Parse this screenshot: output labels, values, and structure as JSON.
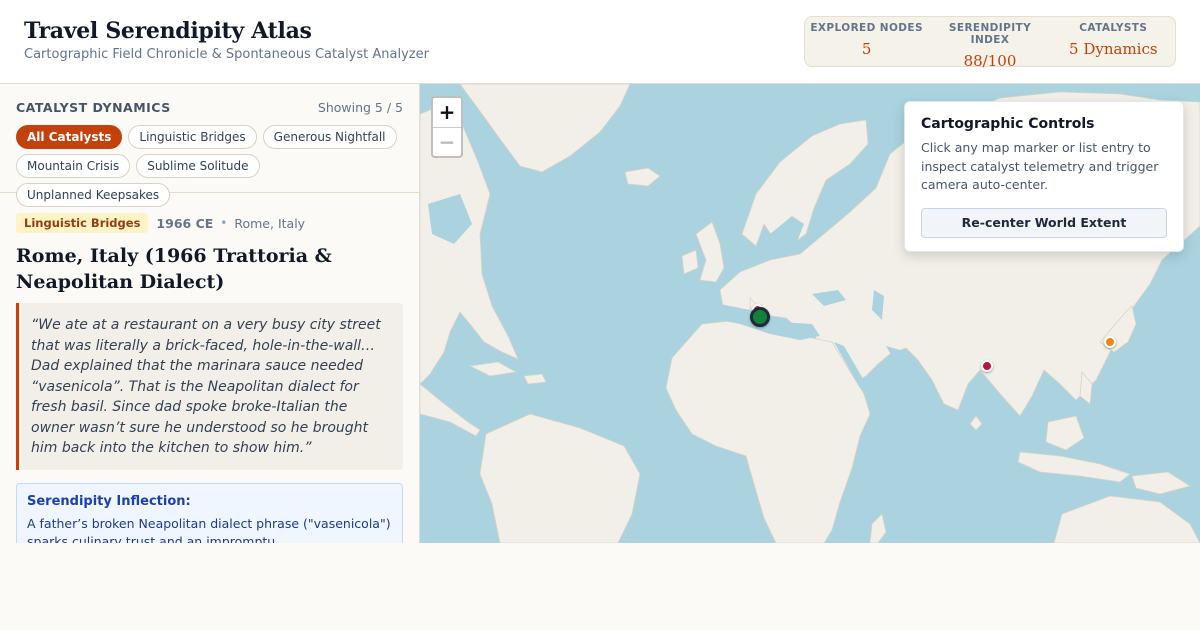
{
  "header": {
    "title": "Travel Serendipity Atlas",
    "subtitle": "Cartographic Field Chronicle & Spontaneous Catalyst Analyzer",
    "stats": [
      {
        "label": "EXPLORED NODES",
        "value": "5"
      },
      {
        "label": "SERENDIPITY INDEX",
        "value": "88/100"
      },
      {
        "label": "CATALYSTS",
        "value": "5 Dynamics"
      }
    ]
  },
  "sidebar": {
    "filter_title": "CATALYST DYNAMICS",
    "filter_count": "Showing 5 / 5",
    "chips": [
      {
        "label": "All Catalysts",
        "active": true
      },
      {
        "label": "Linguistic Bridges",
        "active": false
      },
      {
        "label": "Generous Nightfall",
        "active": false
      },
      {
        "label": "Mountain Crisis",
        "active": false
      },
      {
        "label": "Sublime Solitude",
        "active": false
      },
      {
        "label": "Unplanned Keepsakes",
        "active": false
      }
    ],
    "entry": {
      "tag": "Linguistic Bridges",
      "year": "1966 CE",
      "separator": "•",
      "place": "Rome, Italy",
      "title": "Rome, Italy (1966 Trattoria & Neapolitan Dialect)",
      "quote": "“We ate at a restaurant on a very busy city street that was literally a brick-faced, hole-in-the-wall… Dad explained that the marinara sauce needed “vasenicola”. That is the Neapolitan dialect for fresh basil. Since dad spoke broke-Italian the owner wasn’t sure he understood so he brought him back into the kitchen to show him.”",
      "inflection_title": "Serendipity Inflection:",
      "inflection_text": "A father’s broken Neapolitan dialect phrase (\"vasenicola\") sparks culinary trust and an impromptu"
    }
  },
  "map": {
    "zoom_in": "+",
    "zoom_out": "−",
    "controls": {
      "title": "Cartographic Controls",
      "text": "Click any map marker or list entry to inspect catalyst telemetry and trigger camera auto-center.",
      "button": "Re-center World Extent"
    },
    "colors": {
      "water": "#aad3df",
      "land": "#f2efe9",
      "accent": "#c2410c"
    },
    "markers": [
      {
        "name": "marker-rome",
        "color": "#15803d",
        "selected": true
      },
      {
        "name": "marker-europe-red",
        "color": "#dc2626",
        "selected": false
      },
      {
        "name": "marker-himalaya",
        "color": "#be123c",
        "selected": false
      },
      {
        "name": "marker-japan",
        "color": "#ea8a0c",
        "selected": false
      }
    ]
  }
}
